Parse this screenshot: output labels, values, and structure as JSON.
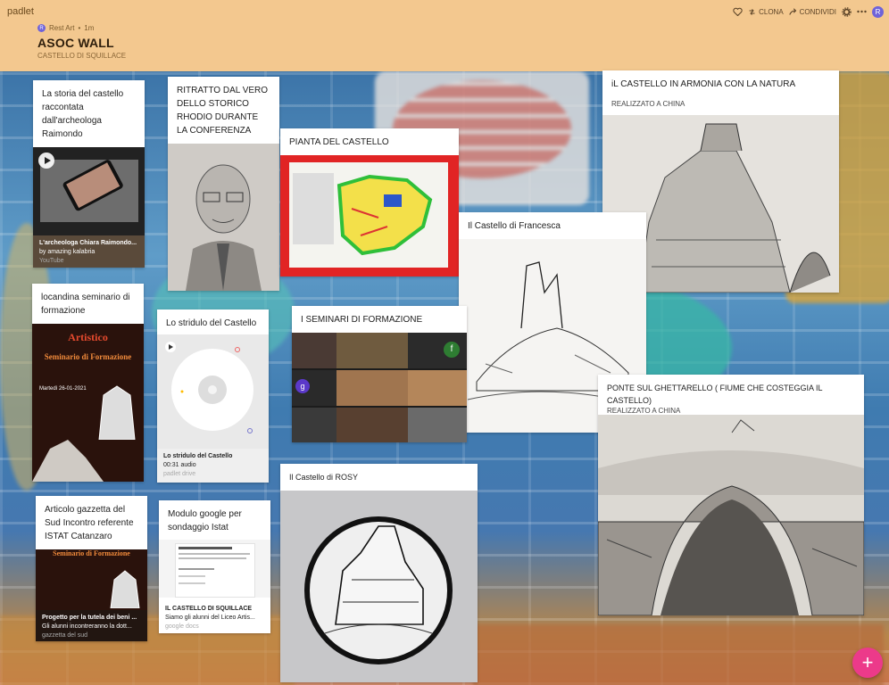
{
  "app": {
    "brand": "padlet"
  },
  "toolbar": {
    "clone_label": "CLONA",
    "share_label": "CONDIVIDI",
    "avatar_initial": "R"
  },
  "board": {
    "author_initial": "R",
    "author": "Rest Art",
    "time_ago": "1m",
    "title": "ASOC WALL",
    "subtitle": "CASTELLO DI SQUILLACE"
  },
  "posts": {
    "storia": {
      "title": "La storia del castello raccontata dall'archeologa Raimondo",
      "attach_title": "L'archeologa Chiara Raimondo...",
      "attach_desc": "by amazing kalabria",
      "attach_source": "YouTube"
    },
    "ritratto": {
      "title": "RITRATTO DAL VERO DELLO STORICO RHODIO DURANTE LA CONFERENZA"
    },
    "pianta": {
      "title": "PIANTA DEL CASTELLO"
    },
    "armonia": {
      "title": "iL CASTELLO IN ARMONIA CON LA NATURA",
      "subtitle": "REALIZZATO A CHINA"
    },
    "francesca": {
      "title": "Il Castello di Francesca"
    },
    "locandina": {
      "title": "locandina seminario di formazione",
      "poster_school": "Artistico",
      "poster_heading": "Seminario di Formazione",
      "poster_date": "Martedì 26-01-2021"
    },
    "stridulo": {
      "title": "Lo stridulo del Castello",
      "attach_title": "Lo stridulo del Castello",
      "attach_desc": "00:31 audio",
      "attach_source": "padlet drive"
    },
    "seminari": {
      "title": "I SEMINARI DI FORMAZIONE",
      "tile_f": "f",
      "tile_g": "g"
    },
    "ghettarello": {
      "title": "PONTE SUL GHETTARELLO ( FIUME CHE COSTEGGIA IL CASTELLO)",
      "subtitle": "REALIZZATO A CHINA"
    },
    "rosy": {
      "title": "Il Castello di ROSY"
    },
    "articolo": {
      "title": "Articolo gazzetta del Sud Incontro referente ISTAT Catanzaro",
      "attach_title": "Progetto per la tutela dei beni ...",
      "attach_desc": "Gli alunni incontreranno la dott...",
      "attach_source": "gazzetta del sud"
    },
    "modulo": {
      "title": "Modulo google per sondaggio Istat",
      "attach_title": "IL CASTELLO DI SQUILLACE",
      "attach_desc": "Siamo gli alunni del Liceo Artis...",
      "attach_source": "google docs"
    }
  },
  "fab": {
    "label": "+"
  },
  "colors": {
    "header": "#f3c88f",
    "fab": "#ec3a8a",
    "avatar": "#6f63d9"
  }
}
